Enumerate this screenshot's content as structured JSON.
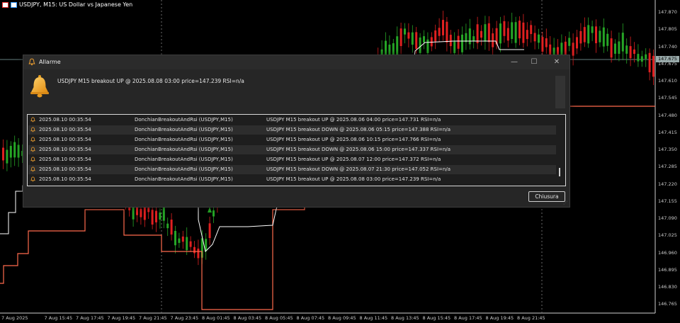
{
  "chart": {
    "title": "USDJPY, M15:  US Dollar vs Japanese Yen",
    "price_labels": [
      "147.870",
      "147.805",
      "147.740",
      "147.675",
      "147.610",
      "147.545",
      "147.480",
      "147.415",
      "147.350",
      "147.285",
      "147.220",
      "147.155",
      "147.090",
      "147.025",
      "146.960",
      "146.895",
      "146.830",
      "146.765"
    ],
    "current_price": "147.675",
    "time_labels": [
      "7 Aug 2025",
      "7 Aug 15:45",
      "7 Aug 17:45",
      "7 Aug 19:45",
      "7 Aug 21:45",
      "7 Aug 23:45",
      "8 Aug 01:45",
      "8 Aug 03:45",
      "8 Aug 05:45",
      "8 Aug 07:45",
      "8 Aug 09:45",
      "8 Aug 11:45",
      "8 Aug 13:45",
      "8 Aug 15:45",
      "8 Aug 17:45",
      "8 Aug 19:45",
      "8 Aug 21:45"
    ],
    "colors": {
      "bull": "#26a626",
      "bear": "#e02020",
      "donchian_upper": "#ffffff",
      "donchian_lower": "#ff6a4d",
      "grid": "#6a6a6a"
    }
  },
  "dialog": {
    "title": "Allarme",
    "message": "USDJPY M15 breakout UP @ 2025.08.08 03:00  price=147.239  RSI=n/a",
    "close_label": "Chiusura",
    "controls": {
      "minimize": "—",
      "maximize": "☐",
      "close": "✕"
    },
    "alerts": [
      {
        "time": "2025.08.10 00:35:54",
        "source": "DonchianBreakoutAndRsi (USDJPY,M15)",
        "message": "USDJPY M15 breakout UP @ 2025.08.06 04:00  price=147.731  RSI=n/a"
      },
      {
        "time": "2025.08.10 00:35:54",
        "source": "DonchianBreakoutAndRsi (USDJPY,M15)",
        "message": "USDJPY M15 breakout DOWN @ 2025.08.06 05:15  price=147.388  RSI=n/a"
      },
      {
        "time": "2025.08.10 00:35:54",
        "source": "DonchianBreakoutAndRsi (USDJPY,M15)",
        "message": "USDJPY M15 breakout UP @ 2025.08.06 10:15  price=147.766  RSI=n/a"
      },
      {
        "time": "2025.08.10 00:35:54",
        "source": "DonchianBreakoutAndRsi (USDJPY,M15)",
        "message": "USDJPY M15 breakout DOWN @ 2025.08.06 15:00  price=147.337  RSI=n/a"
      },
      {
        "time": "2025.08.10 00:35:54",
        "source": "DonchianBreakoutAndRsi (USDJPY,M15)",
        "message": "USDJPY M15 breakout UP @ 2025.08.07 12:00  price=147.372  RSI=n/a"
      },
      {
        "time": "2025.08.10 00:35:54",
        "source": "DonchianBreakoutAndRsi (USDJPY,M15)",
        "message": "USDJPY M15 breakout DOWN @ 2025.08.07 21:30  price=147.052  RSI=n/a"
      },
      {
        "time": "2025.08.10 00:35:54",
        "source": "DonchianBreakoutAndRsi (USDJPY,M15)",
        "message": "USDJPY M15 breakout UP @ 2025.08.08 03:00  price=147.239  RSI=n/a"
      }
    ]
  }
}
